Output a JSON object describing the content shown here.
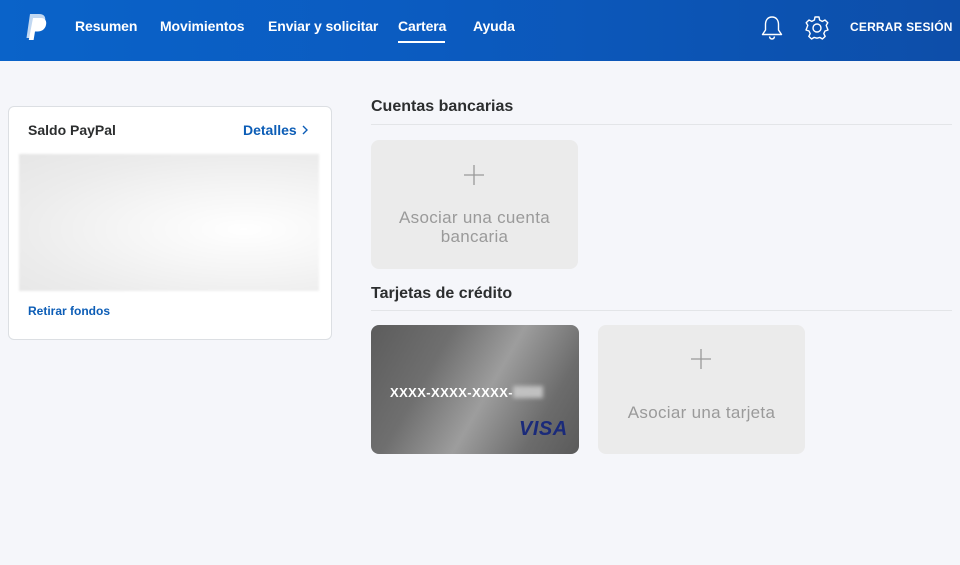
{
  "header": {
    "nav": [
      {
        "label": "Resumen"
      },
      {
        "label": "Movimientos"
      },
      {
        "label": "Enviar y solicitar"
      },
      {
        "label": "Cartera",
        "active": true
      },
      {
        "label": "Ayuda"
      }
    ],
    "logout_label": "CERRAR SESIÓN",
    "icons": [
      "paypal-logo",
      "bell-icon",
      "gear-icon"
    ]
  },
  "balance": {
    "title": "Saldo PayPal",
    "details_label": "Detalles",
    "withdraw_label": "Retirar fondos"
  },
  "bank_accounts": {
    "title": "Cuentas bancarias",
    "add_label": "Asociar una cuenta bancaria"
  },
  "credit_cards": {
    "title": "Tarjetas de crédito",
    "card": {
      "number_prefix": "XXXX-XXXX-XXXX-",
      "brand": "VISA"
    },
    "add_label": "Asociar una tarjeta"
  },
  "colors": {
    "header_blue": "#0b5bc0",
    "link_blue": "#0c5db6",
    "page_bg": "#f5f6fa"
  }
}
